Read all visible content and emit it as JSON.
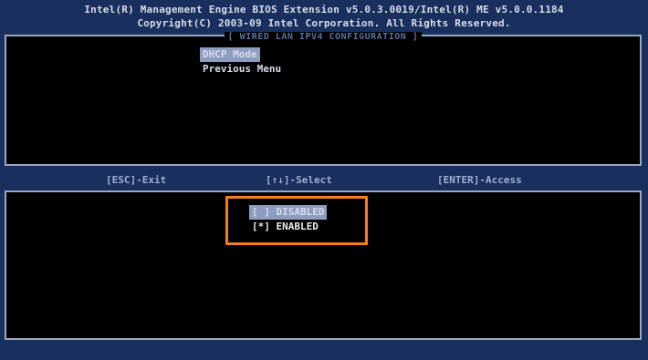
{
  "header": {
    "line1": "Intel(R) Management Engine BIOS Extension v5.0.3.0019/Intel(R) ME v5.0.0.1184",
    "line2": "Copyright(C) 2003-09 Intel Corporation.  All Rights Reserved."
  },
  "top_panel": {
    "title": "[ WIRED LAN IPV4 CONFIGURATION ]",
    "menu": [
      {
        "label": "DHCP Mode",
        "selected": true
      },
      {
        "label": "Previous Menu",
        "selected": false
      }
    ]
  },
  "keybar": {
    "exit": "[ESC]-Exit",
    "select": "[↑↓]-Select",
    "access": "[ENTER]-Access"
  },
  "bottom_panel": {
    "options": [
      {
        "label": "[ ] DISABLED",
        "selected": true
      },
      {
        "label": "[*] ENABLED",
        "selected": false
      }
    ]
  },
  "colors": {
    "background": "#19305e",
    "panel": "#000000",
    "selection": "#8e9cbf",
    "highlight_box": "#f07f24"
  }
}
